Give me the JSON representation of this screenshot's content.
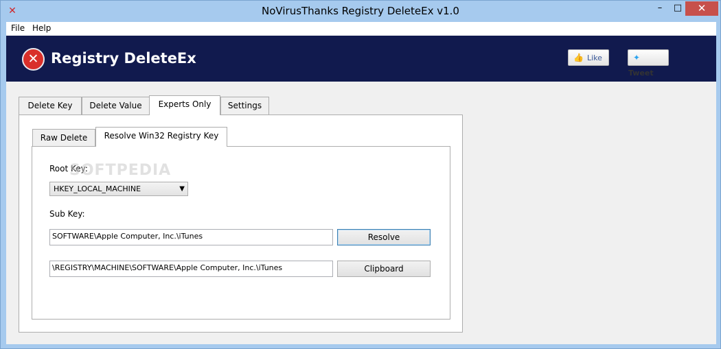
{
  "window": {
    "title": "NoVirusThanks Registry DeleteEx v1.0",
    "app_icon": "red-x-icon",
    "minimize": "–",
    "maximize": "□",
    "close": "✕"
  },
  "menu": {
    "file": "File",
    "help": "Help"
  },
  "banner": {
    "title": "Registry DeleteEx",
    "logo_glyph": "✕",
    "like_label": "Like",
    "tweet_label": "Tweet",
    "background": "#111a4e",
    "accent": "#d92f2a"
  },
  "tabs": {
    "outer": [
      "Delete Key",
      "Delete Value",
      "Experts Only",
      "Settings"
    ],
    "outer_active": "Experts Only",
    "inner": [
      "Raw Delete",
      "Resolve Win32 Registry Key"
    ],
    "inner_active": "Resolve Win32 Registry Key"
  },
  "form": {
    "root_key_label": "Root Key:",
    "root_key_value": "HKEY_LOCAL_MACHINE",
    "sub_key_label": "Sub Key:",
    "sub_key_value": "SOFTWARE\\Apple Computer, Inc.\\iTunes",
    "resolved_value": "\\REGISTRY\\MACHINE\\SOFTWARE\\Apple Computer, Inc.\\iTunes",
    "resolve_button": "Resolve",
    "clipboard_button": "Clipboard"
  },
  "watermark": "SOFTPEDIA"
}
